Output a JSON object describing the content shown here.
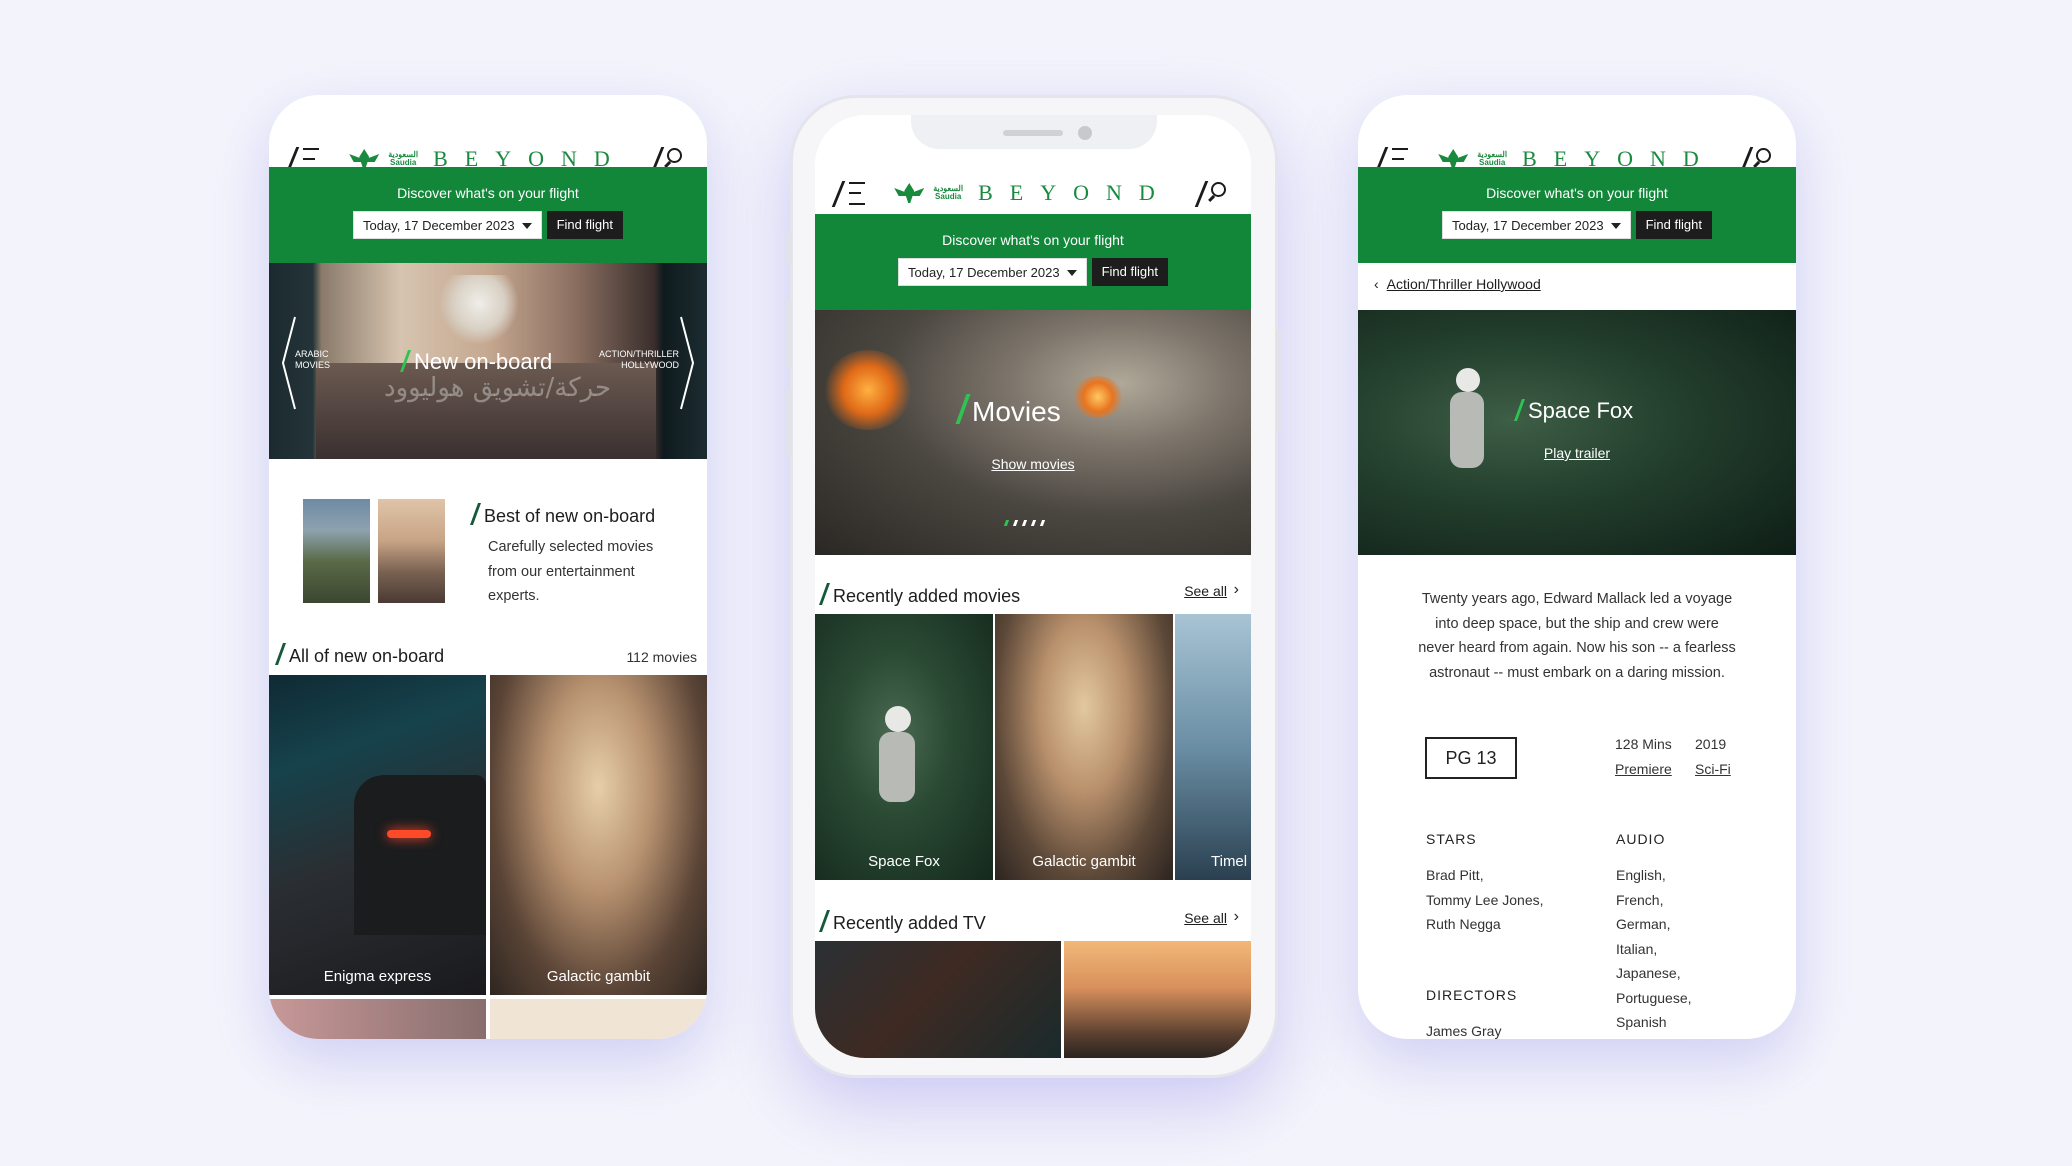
{
  "brand": {
    "logo_text": "BEYOND",
    "airline_ar": "السعودية",
    "airline_en": "Saudia"
  },
  "flight_bar": {
    "discover": "Discover what's on your flight",
    "date": "Today, 17 December 2023",
    "find_button": "Find flight"
  },
  "screen1": {
    "carousel": {
      "title": "New on-board",
      "left_label_1": "ARABIC",
      "left_label_2": "MOVIES",
      "right_label_1": "ACTION/THRILLER",
      "right_label_2": "HOLLYWOOD",
      "arabic_overlay": "حركة/تشويق هوليوود"
    },
    "best": {
      "title": "Best of new on-board",
      "description_lines": [
        "Carefully selected movies",
        "from our entertainment",
        "experts."
      ]
    },
    "all_section": {
      "title": "All of new on-board",
      "count": "112 movies"
    },
    "cards": [
      {
        "label": "Enigma express"
      },
      {
        "label": "Galactic gambit"
      }
    ]
  },
  "screen2": {
    "hero": {
      "title": "Movies",
      "link": "Show movies"
    },
    "recent_movies": {
      "title": "Recently added movies",
      "see_all": "See all",
      "cards": [
        {
          "label": "Space Fox"
        },
        {
          "label": "Galactic gambit"
        },
        {
          "label": "Timel"
        }
      ]
    },
    "recent_tv": {
      "title": "Recently added TV",
      "see_all": "See all"
    }
  },
  "screen3": {
    "breadcrumb": "Action/Thriller Hollywood",
    "hero": {
      "title": "Space Fox",
      "link": "Play trailer"
    },
    "synopsis_lines": [
      "Twenty years ago, Edward Mallack led a voyage",
      "into deep space, but the ship and crew were",
      "never heard from again. Now his son -- a fearless",
      "astronaut -- must embark on a daring mission."
    ],
    "rating": "PG 13",
    "duration": "128 Mins",
    "year": "2019",
    "tag_premiere": "Premiere",
    "tag_genre": "Sci-Fi",
    "stars_label": "STARS",
    "stars": [
      "Brad Pitt,",
      "Tommy Lee Jones,",
      "Ruth Negga"
    ],
    "audio_label": "AUDIO",
    "audio": [
      "English,",
      "French,",
      "German,",
      "Italian,",
      "Japanese,",
      "Portuguese,",
      "Spanish"
    ],
    "directors_label": "DIRECTORS",
    "directors": [
      "James Gray"
    ]
  },
  "colors": {
    "brand_green": "#12873a",
    "accent_green": "#2fc354",
    "background": "#f3f4fb"
  }
}
